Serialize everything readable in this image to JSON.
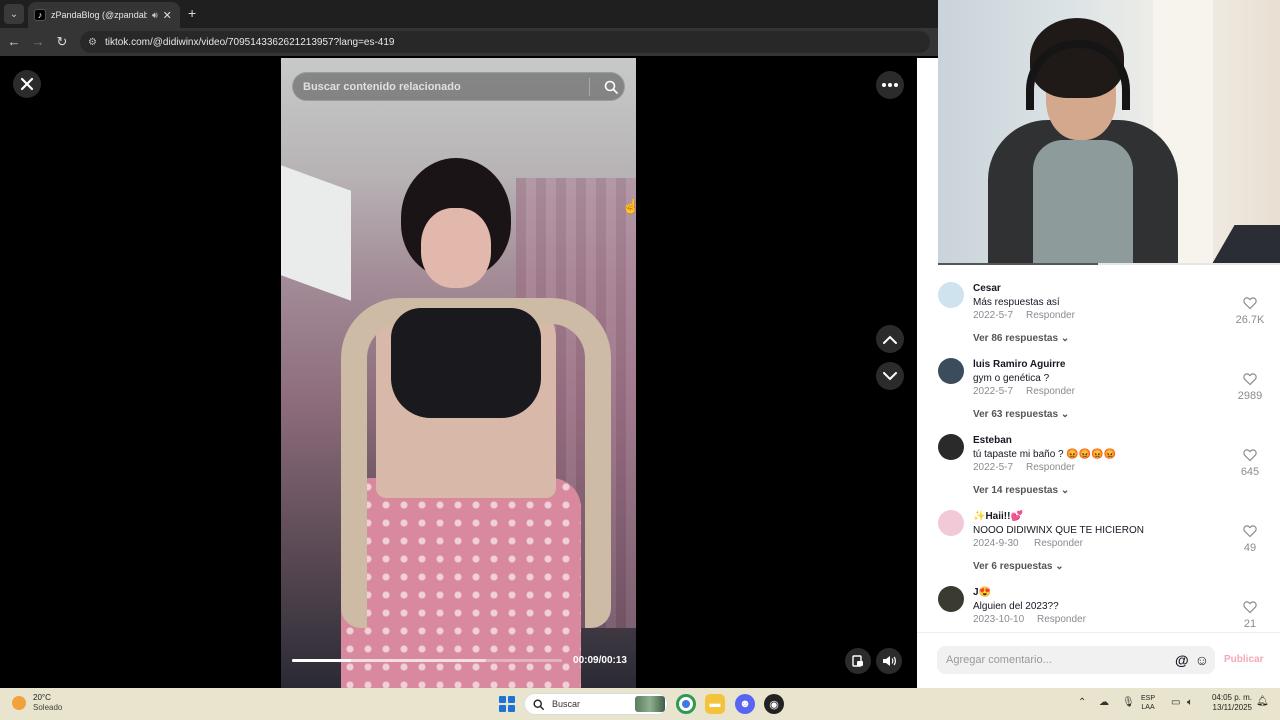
{
  "browser": {
    "tab_title": "zPandaBlog (@zpandablog",
    "tab_favicon": "tiktok-icon",
    "url": "tiktok.com/@didiwinx/video/7095143362621213957?lang=es-419",
    "new_tab_symbol": "+"
  },
  "video": {
    "search_placeholder": "Buscar contenido relacionado",
    "time_display": "00:09/00:13",
    "progress_fraction": 0.22,
    "buffer_fraction": 0.72
  },
  "comments": [
    {
      "author": "Cesar",
      "text": "Más respuestas así",
      "date": "2022-5-7",
      "reply_label": "Responder",
      "likes": "26.7K",
      "more": "Ver 86 respuestas",
      "avatar_color": "#cfe3ee"
    },
    {
      "author": "luis Ramiro Aguirre",
      "text": "gym o genética ?",
      "date": "2022-5-7",
      "reply_label": "Responder",
      "likes": "2989",
      "more": "Ver 63 respuestas",
      "avatar_color": "#3b4c5c"
    },
    {
      "author": "Esteban",
      "text": "tú tapaste mi baño ? 😡😡😡😡",
      "date": "2022-5-7",
      "reply_label": "Responder",
      "likes": "645",
      "more": "Ver 14 respuestas",
      "avatar_color": "#2a2a2a"
    },
    {
      "author": "✨Haii!!💕",
      "text": "NOOO DIDIWINX QUE TE HICIERON",
      "date": "2024-9-30",
      "reply_label": "Responder",
      "likes": "49",
      "more": "Ver 6 respuestas",
      "avatar_color": "#f2c9d6"
    },
    {
      "author": "J😍",
      "text": "Alguien del 2023??",
      "date": "2023-10-10",
      "reply_label": "Responder",
      "likes": "21",
      "more": "",
      "avatar_color": "#3a3a30"
    }
  ],
  "composer": {
    "placeholder": "Agregar comentario...",
    "at_symbol": "@",
    "publish_label": "Publicar"
  },
  "taskbar": {
    "temperature": "20°C",
    "weather_text": "Soleado",
    "search_placeholder": "Buscar",
    "lang_line1": "ESP",
    "lang_line2": "LAA",
    "time": "04:05 p. m.",
    "date": "13/11/2025"
  }
}
